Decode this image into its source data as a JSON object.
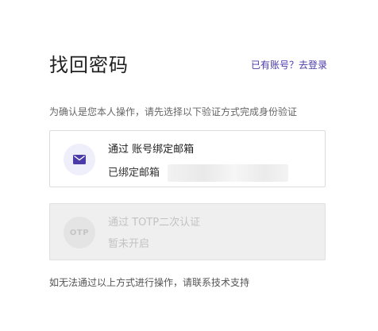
{
  "header": {
    "title": "找回密码",
    "login_prompt": "已有账号？",
    "login_link": "去登录"
  },
  "hint": "为确认是您本人操作，请先选择以下验证方式完成身份验证",
  "methods": [
    {
      "icon": "mail-icon",
      "title": "通过 账号绑定邮箱",
      "subtitle": "已绑定邮箱",
      "enabled": true
    },
    {
      "icon": "otp-icon",
      "icon_text": "OTP",
      "title": "通过 TOTP二次认证",
      "subtitle": "暂未开启",
      "enabled": false
    }
  ],
  "footer": "如无法通过以上方式进行操作，请联系技术支持",
  "colors": {
    "accent": "#4a3aa8",
    "mail_icon": "#4b3ba8",
    "disabled_bg": "#efefef"
  }
}
